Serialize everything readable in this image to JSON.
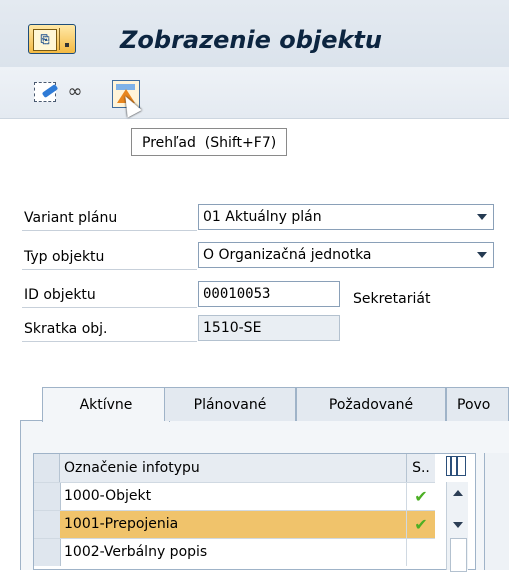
{
  "window": {
    "title": "Zobrazenie objektu",
    "app_menu_icon": "sap-menu-icon"
  },
  "toolbar": {
    "buttons": [
      {
        "icon": "change-edit-icon"
      },
      {
        "icon": "glasses-display-icon"
      },
      {
        "icon": "overview-mountain-icon"
      }
    ],
    "tooltip": "Prehľad  (Shift+F7)"
  },
  "form": {
    "plan_variant": {
      "label": "Variant plánu",
      "value": "01 Aktuálny plán"
    },
    "object_type": {
      "label": "Typ objektu",
      "value": "O Organizačná jednotka"
    },
    "object_id": {
      "label": "ID objektu",
      "value": "00010053",
      "description": "Sekretariát"
    },
    "object_abbr": {
      "label": "Skratka obj.",
      "value": "1510-SE"
    }
  },
  "tabs": [
    {
      "label": "Aktívne",
      "active": true
    },
    {
      "label": "Plánované",
      "active": false
    },
    {
      "label": "Požadované",
      "active": false
    },
    {
      "label": "Povo",
      "active": false
    }
  ],
  "table": {
    "columns": [
      "Označenie infotypu",
      "S.."
    ],
    "rows": [
      {
        "name": "1000-Objekt",
        "status": "✔",
        "highlighted": false
      },
      {
        "name": "1001-Prepojenia",
        "status": "✔",
        "highlighted": true
      },
      {
        "name": "1002-Verbálny popis",
        "status": "",
        "highlighted": false
      }
    ]
  }
}
